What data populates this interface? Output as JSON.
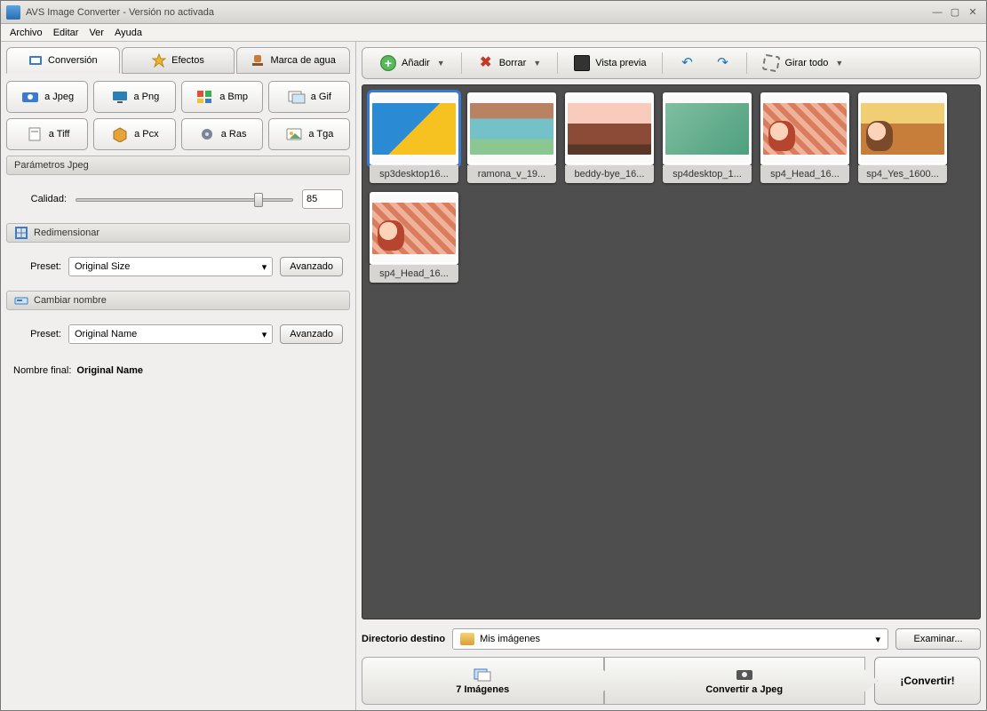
{
  "window": {
    "title": "AVS Image Converter - Versión no activada"
  },
  "menu": {
    "archivo": "Archivo",
    "editar": "Editar",
    "ver": "Ver",
    "ayuda": "Ayuda"
  },
  "tabs": {
    "conversion": "Conversión",
    "efectos": "Efectos",
    "marca": "Marca de agua"
  },
  "formats": {
    "jpeg": "a Jpeg",
    "png": "a Png",
    "bmp": "a Bmp",
    "gif": "a Gif",
    "tiff": "a Tiff",
    "pcx": "a Pcx",
    "ras": "a Ras",
    "tga": "a Tga"
  },
  "jpeg_params": {
    "header": "Parámetros Jpeg",
    "quality_label": "Calidad:",
    "quality_value": "85"
  },
  "resize": {
    "header": "Redimensionar",
    "preset_label": "Preset:",
    "preset_value": "Original Size",
    "advanced": "Avanzado"
  },
  "rename": {
    "header": "Cambiar nombre",
    "preset_label": "Preset:",
    "preset_value": "Original Name",
    "advanced": "Avanzado",
    "final_label": "Nombre final:",
    "final_value": "Original Name"
  },
  "toolbar": {
    "add": "Añadir",
    "delete": "Borrar",
    "preview": "Vista previa",
    "rotate_all": "Girar todo"
  },
  "thumbs": [
    {
      "name": "sp3desktop16...",
      "cls": "img1",
      "selected": true
    },
    {
      "name": "ramona_v_19...",
      "cls": "img2",
      "selected": false
    },
    {
      "name": "beddy-bye_16...",
      "cls": "img3",
      "selected": false
    },
    {
      "name": "sp4desktop_1...",
      "cls": "img4",
      "selected": false
    },
    {
      "name": "sp4_Head_16...",
      "cls": "img5",
      "selected": false
    },
    {
      "name": "sp4_Yes_1600...",
      "cls": "img6",
      "selected": false
    },
    {
      "name": "sp4_Head_16...",
      "cls": "img5",
      "selected": false
    }
  ],
  "dest": {
    "label": "Directorio destino",
    "value": "Mis imágenes",
    "browse": "Examinar..."
  },
  "action": {
    "images": "7 Imágenes",
    "to": "Convertir a Jpeg",
    "go": "¡Convertir!"
  }
}
